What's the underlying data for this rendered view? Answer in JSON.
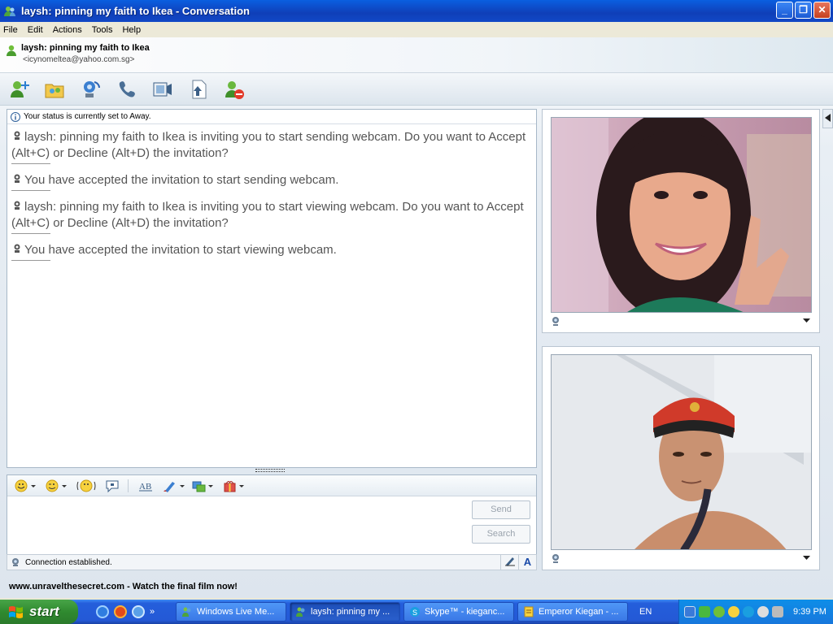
{
  "window": {
    "title": "laysh: pinning my faith to Ikea - Conversation",
    "buttons": {
      "minimize": "_",
      "maximize": "❐",
      "close": "✕"
    }
  },
  "menu": [
    "File",
    "Edit",
    "Actions",
    "Tools",
    "Help"
  ],
  "contact": {
    "name": "laysh: pinning my faith to Ikea",
    "email": "<icynomeltea@yahoo.com.sg>"
  },
  "toolbar_icons": [
    "invite-contact-icon",
    "share-folder-icon",
    "webcam-call-icon",
    "phone-call-icon",
    "video-icon",
    "send-file-icon",
    "block-icon"
  ],
  "conversation": {
    "status": "Your status is currently set to Away.",
    "messages": [
      "laysh: pinning my faith to Ikea is inviting you to start sending webcam. Do you want to Accept (Alt+C) or Decline (Alt+D) the invitation?",
      "You have accepted the invitation to start sending webcam.",
      "laysh: pinning my faith to Ikea is inviting you to start viewing webcam. Do you want to Accept (Alt+C) or Decline (Alt+D) the invitation?",
      "You have accepted the invitation to start viewing webcam."
    ]
  },
  "compose": {
    "send_label": "Send",
    "search_label": "Search",
    "font_button": "A",
    "connection_status": "Connection established."
  },
  "footer": {
    "ad_text": "www.unravelthesecret.com - Watch the final film now!"
  },
  "taskbar": {
    "start_label": "start",
    "tasks": [
      {
        "label": "Windows Live Me...",
        "active": false
      },
      {
        "label": "laysh: pinning my ...",
        "active": true
      },
      {
        "label": "Skype™ - kieganc...",
        "active": false
      },
      {
        "label": "Emperor Kiegan - ...",
        "active": false
      }
    ],
    "language": "EN",
    "clock": "9:39 PM"
  },
  "colors": {
    "titlebar": "#0f3fb8",
    "taskbar": "#245edb",
    "start": "#2f8a2f"
  }
}
